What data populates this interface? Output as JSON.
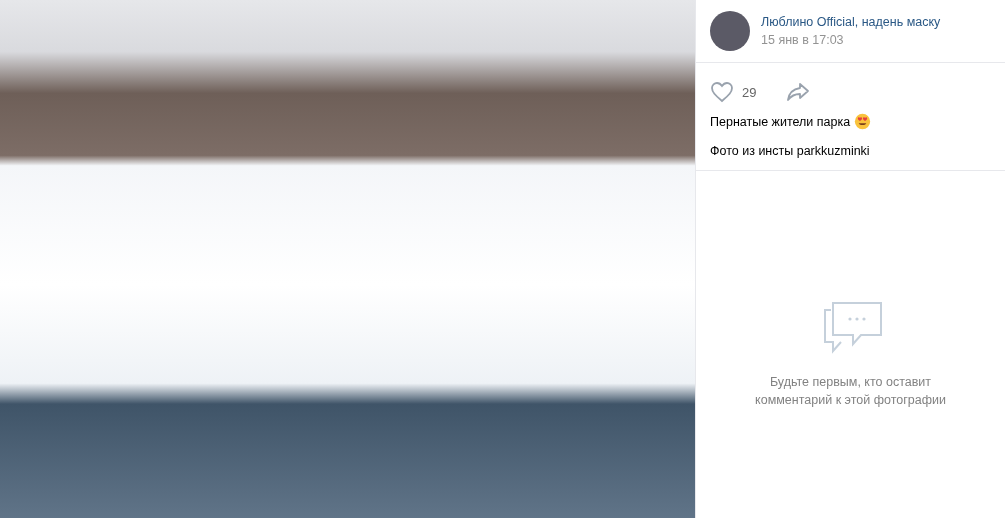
{
  "post": {
    "author": "Люблино Official, надень маску",
    "date": "15 янв в 17:03"
  },
  "actions": {
    "likes": "29",
    "liked": false
  },
  "caption": [
    "Пернатые жители парка",
    "Фото из инсты parkkuzminki"
  ],
  "comments": {
    "empty_text": "Будьте первым, кто оставит комментарий к этой фотографии"
  }
}
